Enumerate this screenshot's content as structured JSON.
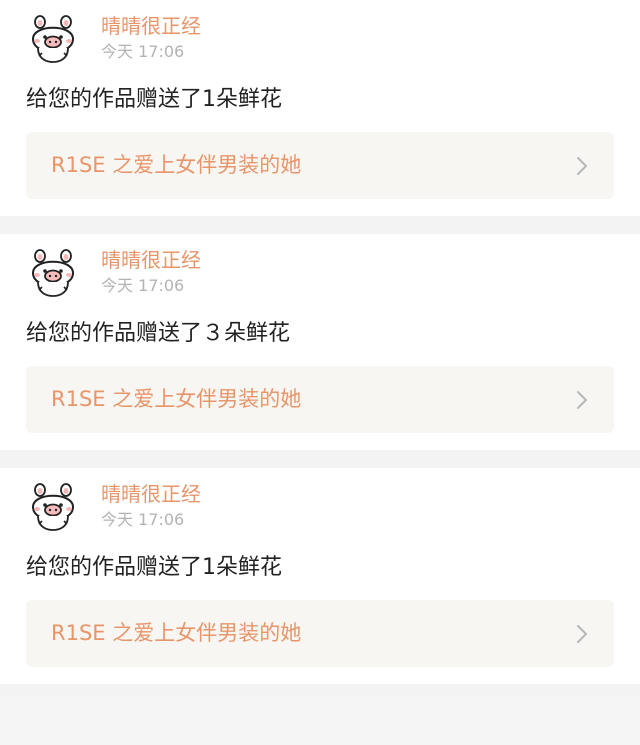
{
  "notifications": [
    {
      "username": "晴晴很正经",
      "time": "今天 17:06",
      "message": "给您的作品赠送了1朵鲜花",
      "work_title": "R1SE 之爱上女伴男装的她"
    },
    {
      "username": "晴晴很正经",
      "time": "今天 17:06",
      "message": "给您的作品赠送了３朵鲜花",
      "work_title": "R1SE 之爱上女伴男装的她"
    },
    {
      "username": "晴晴很正经",
      "time": "今天 17:06",
      "message": "给您的作品赠送了1朵鲜花",
      "work_title": "R1SE 之爱上女伴男装的她"
    }
  ],
  "colors": {
    "accent": "#e8956a",
    "timestamp": "#b3b3b3",
    "card_link_bg": "#f7f6f2",
    "separator": "#f3f3f3"
  },
  "icons": {
    "avatar": "pig-avatar-icon",
    "link_arrow": "chevron-right-icon"
  }
}
